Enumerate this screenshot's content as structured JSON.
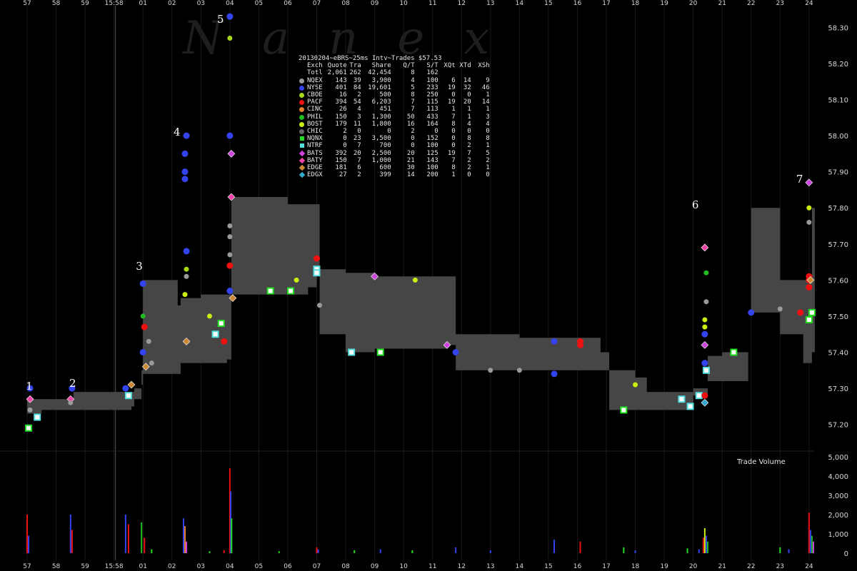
{
  "watermark": "Nanex",
  "stats": {
    "title": "20130204~eBRS~25ms Intv~Trades $57.53",
    "headers": [
      "Exch",
      "Quote",
      "Tra",
      "Share",
      "Q/T",
      "S/T",
      "XQt",
      "XTd",
      "XSh"
    ],
    "total": [
      "Totl",
      "2,061",
      "262",
      "42,454",
      "8",
      "162",
      "",
      "",
      ""
    ],
    "rows": [
      {
        "name": "NQEX",
        "shape": "dot",
        "color": "#9a9a9a",
        "vals": [
          "143",
          "39",
          "3,900",
          "4",
          "100",
          "6",
          "14",
          "9"
        ]
      },
      {
        "name": "NYSE",
        "shape": "dot",
        "color": "#3344ee",
        "vals": [
          "401",
          "84",
          "19,601",
          "5",
          "233",
          "19",
          "32",
          "46"
        ]
      },
      {
        "name": "CBOE",
        "shape": "dot",
        "color": "#a8d81a",
        "vals": [
          "16",
          "2",
          "500",
          "8",
          "250",
          "0",
          "0",
          "1"
        ]
      },
      {
        "name": "PACF",
        "shape": "dot",
        "color": "#ee1111",
        "vals": [
          "394",
          "54",
          "6,203",
          "7",
          "115",
          "19",
          "20",
          "14"
        ]
      },
      {
        "name": "CINC",
        "shape": "dot",
        "color": "#e08030",
        "vals": [
          "26",
          "4",
          "451",
          "7",
          "113",
          "1",
          "1",
          "1"
        ]
      },
      {
        "name": "PHIL",
        "shape": "dot",
        "color": "#22bb22",
        "vals": [
          "150",
          "3",
          "1,300",
          "50",
          "433",
          "7",
          "1",
          "3"
        ]
      },
      {
        "name": "BOST",
        "shape": "dot",
        "color": "#ccee11",
        "vals": [
          "179",
          "11",
          "1,800",
          "16",
          "164",
          "8",
          "4",
          "4"
        ]
      },
      {
        "name": "CHIC",
        "shape": "dot",
        "color": "#666666",
        "vals": [
          "2",
          "0",
          "0",
          "2",
          "0",
          "0",
          "0",
          "0"
        ]
      },
      {
        "name": "NQNX",
        "shape": "sq",
        "color": "#22dd22",
        "vals": [
          "0",
          "23",
          "3,500",
          "0",
          "152",
          "0",
          "8",
          "8"
        ]
      },
      {
        "name": "NTRF",
        "shape": "sq",
        "color": "#55dddd",
        "vals": [
          "0",
          "7",
          "700",
          "0",
          "100",
          "0",
          "2",
          "1"
        ]
      },
      {
        "name": "BATS",
        "shape": "dia",
        "color": "#cc44dd",
        "vals": [
          "392",
          "20",
          "2,500",
          "20",
          "125",
          "19",
          "7",
          "5"
        ]
      },
      {
        "name": "BATY",
        "shape": "dia",
        "color": "#ee44aa",
        "vals": [
          "150",
          "7",
          "1,000",
          "21",
          "143",
          "7",
          "2",
          "2"
        ]
      },
      {
        "name": "EDGE",
        "shape": "dia",
        "color": "#cc8833",
        "vals": [
          "181",
          "6",
          "600",
          "30",
          "100",
          "8",
          "2",
          "1"
        ]
      },
      {
        "name": "EDGX",
        "shape": "dia",
        "color": "#33aacc",
        "vals": [
          "27",
          "2",
          "399",
          "14",
          "200",
          "1",
          "0",
          "0"
        ]
      }
    ]
  },
  "volume_label": "Trade Volume",
  "chart_data": {
    "type": "line",
    "title": "20130204~eBRS~25ms Intv~Trades $57.53",
    "x_tick_labels": [
      "57",
      "58",
      "59",
      "15:58",
      "01",
      "02",
      "03",
      "04",
      "05",
      "06",
      "07",
      "08",
      "09",
      "10",
      "11",
      "12",
      "13",
      "14",
      "15",
      "16",
      "17",
      "18",
      "19",
      "20",
      "21",
      "22",
      "23",
      "24"
    ],
    "price_axis": {
      "ticks": [
        "57.20",
        "57.30",
        "57.40",
        "57.50",
        "57.60",
        "57.70",
        "57.80",
        "57.90",
        "58.00",
        "58.10",
        "58.20",
        "58.30"
      ],
      "ylim": [
        57.14,
        58.36
      ]
    },
    "volume_axis": {
      "ticks": [
        "0",
        "1,000",
        "2,000",
        "3,000",
        "4,000",
        "5,000"
      ],
      "ylim": [
        0,
        5000
      ]
    },
    "event_labels": [
      {
        "label": "1",
        "x": 0.4
      },
      {
        "label": "2",
        "x": 1.9
      },
      {
        "label": "3",
        "x": 4.2
      },
      {
        "label": "4",
        "x": 5.5
      },
      {
        "label": "5",
        "x": 7.0
      },
      {
        "label": "6",
        "x": 23.4
      },
      {
        "label": "7",
        "x": 27.0
      }
    ],
    "nbbo_series": [
      {
        "x": 0.0,
        "bid": 57.23,
        "ask": 57.27
      },
      {
        "x": 0.4,
        "bid": 57.23,
        "ask": 57.27
      },
      {
        "x": 0.5,
        "bid": 57.24,
        "ask": 57.27
      },
      {
        "x": 1.5,
        "bid": 57.24,
        "ask": 57.27
      },
      {
        "x": 1.6,
        "bid": 57.24,
        "ask": 57.29
      },
      {
        "x": 3.6,
        "bid": 57.25,
        "ask": 57.29
      },
      {
        "x": 3.7,
        "bid": 57.27,
        "ask": 57.3
      },
      {
        "x": 3.95,
        "bid": 57.31,
        "ask": 57.35
      },
      {
        "x": 4.0,
        "bid": 57.34,
        "ask": 57.6
      },
      {
        "x": 5.2,
        "bid": 57.34,
        "ask": 57.53
      },
      {
        "x": 5.3,
        "bid": 57.37,
        "ask": 57.55
      },
      {
        "x": 6.0,
        "bid": 57.37,
        "ask": 57.56
      },
      {
        "x": 6.5,
        "bid": 57.37,
        "ask": 57.56
      },
      {
        "x": 6.9,
        "bid": 57.38,
        "ask": 57.56
      },
      {
        "x": 7.05,
        "bid": 57.56,
        "ask": 57.83
      },
      {
        "x": 8.8,
        "bid": 57.56,
        "ask": 57.83
      },
      {
        "x": 9.0,
        "bid": 57.56,
        "ask": 57.81
      },
      {
        "x": 9.7,
        "bid": 57.58,
        "ask": 57.81
      },
      {
        "x": 10.0,
        "bid": 57.63,
        "ask": 57.81
      },
      {
        "x": 10.1,
        "bid": 57.45,
        "ask": 57.63
      },
      {
        "x": 11.0,
        "bid": 57.4,
        "ask": 57.62
      },
      {
        "x": 12.0,
        "bid": 57.41,
        "ask": 57.61
      },
      {
        "x": 13.0,
        "bid": 57.41,
        "ask": 57.61
      },
      {
        "x": 14.5,
        "bid": 57.42,
        "ask": 57.61
      },
      {
        "x": 14.8,
        "bid": 57.35,
        "ask": 57.45
      },
      {
        "x": 17.0,
        "bid": 57.35,
        "ask": 57.44
      },
      {
        "x": 18.0,
        "bid": 57.35,
        "ask": 57.44
      },
      {
        "x": 19.8,
        "bid": 57.35,
        "ask": 57.4
      },
      {
        "x": 20.1,
        "bid": 57.24,
        "ask": 57.35
      },
      {
        "x": 21.0,
        "bid": 57.24,
        "ask": 57.33
      },
      {
        "x": 21.4,
        "bid": 57.24,
        "ask": 57.29
      },
      {
        "x": 22.8,
        "bid": 57.24,
        "ask": 57.29
      },
      {
        "x": 23.0,
        "bid": 57.28,
        "ask": 57.3
      },
      {
        "x": 23.5,
        "bid": 57.32,
        "ask": 57.39
      },
      {
        "x": 24.0,
        "bid": 57.32,
        "ask": 57.4
      },
      {
        "x": 24.9,
        "bid": 57.4,
        "ask": 57.4
      },
      {
        "x": 25.0,
        "bid": 57.51,
        "ask": 57.8
      },
      {
        "x": 25.9,
        "bid": 57.51,
        "ask": 57.8
      },
      {
        "x": 26.0,
        "bid": 57.45,
        "ask": 57.6
      },
      {
        "x": 26.8,
        "bid": 57.37,
        "ask": 57.6
      },
      {
        "x": 27.1,
        "bid": 57.4,
        "ask": 57.8
      }
    ],
    "trades": [
      {
        "x": 0.1,
        "price": 57.24,
        "ex": "NQEX"
      },
      {
        "x": 0.1,
        "price": 57.3,
        "ex": "NYSE"
      },
      {
        "x": 0.1,
        "price": 57.27,
        "ex": "BATY"
      },
      {
        "x": 0.05,
        "price": 57.19,
        "ex": "NQNX"
      },
      {
        "x": 0.35,
        "price": 57.22,
        "ex": "NTRF"
      },
      {
        "x": 1.55,
        "price": 57.3,
        "ex": "NYSE"
      },
      {
        "x": 1.5,
        "price": 57.27,
        "ex": "BATY"
      },
      {
        "x": 1.5,
        "price": 57.26,
        "ex": "NQEX"
      },
      {
        "x": 3.4,
        "price": 57.3,
        "ex": "NYSE"
      },
      {
        "x": 3.5,
        "price": 57.28,
        "ex": "NTRF"
      },
      {
        "x": 3.6,
        "price": 57.31,
        "ex": "EDGE"
      },
      {
        "x": 4.0,
        "price": 57.5,
        "ex": "PHIL"
      },
      {
        "x": 4.0,
        "price": 57.59,
        "ex": "NYSE"
      },
      {
        "x": 4.0,
        "price": 57.4,
        "ex": "NYSE"
      },
      {
        "x": 4.05,
        "price": 57.47,
        "ex": "PACF"
      },
      {
        "x": 4.1,
        "price": 57.36,
        "ex": "EDGE"
      },
      {
        "x": 4.3,
        "price": 57.37,
        "ex": "NQEX"
      },
      {
        "x": 4.2,
        "price": 57.43,
        "ex": "NQEX"
      },
      {
        "x": 5.5,
        "price": 58.0,
        "ex": "NYSE"
      },
      {
        "x": 5.45,
        "price": 57.95,
        "ex": "NYSE"
      },
      {
        "x": 5.45,
        "price": 57.9,
        "ex": "NYSE"
      },
      {
        "x": 5.45,
        "price": 57.88,
        "ex": "NYSE"
      },
      {
        "x": 5.5,
        "price": 57.68,
        "ex": "NYSE"
      },
      {
        "x": 5.5,
        "price": 57.63,
        "ex": "CBOE"
      },
      {
        "x": 5.5,
        "price": 57.61,
        "ex": "NQEX"
      },
      {
        "x": 5.45,
        "price": 57.56,
        "ex": "BOST"
      },
      {
        "x": 5.5,
        "price": 57.43,
        "ex": "EDGE"
      },
      {
        "x": 6.3,
        "price": 57.5,
        "ex": "BOST"
      },
      {
        "x": 6.7,
        "price": 57.48,
        "ex": "NQNX"
      },
      {
        "x": 6.5,
        "price": 57.45,
        "ex": "NTRF"
      },
      {
        "x": 6.8,
        "price": 57.43,
        "ex": "PACF"
      },
      {
        "x": 7.0,
        "price": 58.33,
        "ex": "NYSE"
      },
      {
        "x": 7.0,
        "price": 58.27,
        "ex": "CBOE"
      },
      {
        "x": 7.0,
        "price": 58.0,
        "ex": "NYSE"
      },
      {
        "x": 7.05,
        "price": 57.95,
        "ex": "BATS"
      },
      {
        "x": 7.05,
        "price": 57.83,
        "ex": "BATY"
      },
      {
        "x": 7.0,
        "price": 57.75,
        "ex": "NQEX"
      },
      {
        "x": 7.0,
        "price": 57.72,
        "ex": "NQEX"
      },
      {
        "x": 7.0,
        "price": 57.67,
        "ex": "NQEX"
      },
      {
        "x": 7.0,
        "price": 57.64,
        "ex": "PACF"
      },
      {
        "x": 7.0,
        "price": 57.57,
        "ex": "NYSE"
      },
      {
        "x": 7.1,
        "price": 57.55,
        "ex": "EDGE"
      },
      {
        "x": 8.4,
        "price": 57.57,
        "ex": "NQNX"
      },
      {
        "x": 9.1,
        "price": 57.57,
        "ex": "NQNX"
      },
      {
        "x": 9.3,
        "price": 57.6,
        "ex": "BOST"
      },
      {
        "x": 10.0,
        "price": 57.66,
        "ex": "PACF"
      },
      {
        "x": 10.0,
        "price": 57.63,
        "ex": "NTRF"
      },
      {
        "x": 10.0,
        "price": 57.62,
        "ex": "NTRF"
      },
      {
        "x": 10.1,
        "price": 57.53,
        "ex": "NQEX"
      },
      {
        "x": 11.2,
        "price": 57.4,
        "ex": "NTRF"
      },
      {
        "x": 12.2,
        "price": 57.4,
        "ex": "NQNX"
      },
      {
        "x": 12.0,
        "price": 57.61,
        "ex": "BATS"
      },
      {
        "x": 13.4,
        "price": 57.6,
        "ex": "BOST"
      },
      {
        "x": 14.5,
        "price": 57.42,
        "ex": "BATS"
      },
      {
        "x": 14.8,
        "price": 57.4,
        "ex": "NYSE"
      },
      {
        "x": 16.0,
        "price": 57.35,
        "ex": "NQEX"
      },
      {
        "x": 17.0,
        "price": 57.35,
        "ex": "NQEX"
      },
      {
        "x": 18.2,
        "price": 57.34,
        "ex": "NYSE"
      },
      {
        "x": 18.2,
        "price": 57.43,
        "ex": "NYSE"
      },
      {
        "x": 19.1,
        "price": 57.43,
        "ex": "PACF"
      },
      {
        "x": 19.1,
        "price": 57.42,
        "ex": "PACF"
      },
      {
        "x": 20.6,
        "price": 57.24,
        "ex": "NQNX"
      },
      {
        "x": 21.0,
        "price": 57.31,
        "ex": "BOST"
      },
      {
        "x": 22.6,
        "price": 57.27,
        "ex": "NTRF"
      },
      {
        "x": 22.9,
        "price": 57.25,
        "ex": "NTRF"
      },
      {
        "x": 23.2,
        "price": 57.28,
        "ex": "NTRF"
      },
      {
        "x": 23.4,
        "price": 57.69,
        "ex": "BATY"
      },
      {
        "x": 23.45,
        "price": 57.62,
        "ex": "PHIL"
      },
      {
        "x": 23.45,
        "price": 57.54,
        "ex": "NQEX"
      },
      {
        "x": 23.4,
        "price": 57.49,
        "ex": "BOST"
      },
      {
        "x": 23.4,
        "price": 57.47,
        "ex": "BOST"
      },
      {
        "x": 23.4,
        "price": 57.45,
        "ex": "NYSE"
      },
      {
        "x": 23.4,
        "price": 57.42,
        "ex": "BATS"
      },
      {
        "x": 23.4,
        "price": 57.37,
        "ex": "NYSE"
      },
      {
        "x": 23.45,
        "price": 57.35,
        "ex": "NTRF"
      },
      {
        "x": 23.4,
        "price": 57.28,
        "ex": "PACF"
      },
      {
        "x": 23.4,
        "price": 57.26,
        "ex": "EDGX"
      },
      {
        "x": 24.4,
        "price": 57.4,
        "ex": "NQNX"
      },
      {
        "x": 25.0,
        "price": 57.51,
        "ex": "NYSE"
      },
      {
        "x": 26.0,
        "price": 57.52,
        "ex": "NQEX"
      },
      {
        "x": 26.7,
        "price": 57.51,
        "ex": "PACF"
      },
      {
        "x": 27.0,
        "price": 57.87,
        "ex": "BATS"
      },
      {
        "x": 27.0,
        "price": 57.8,
        "ex": "BOST"
      },
      {
        "x": 27.0,
        "price": 57.76,
        "ex": "NQEX"
      },
      {
        "x": 27.0,
        "price": 57.61,
        "ex": "PACF"
      },
      {
        "x": 27.0,
        "price": 57.6,
        "ex": "PACF"
      },
      {
        "x": 27.05,
        "price": 57.6,
        "ex": "EDGE"
      },
      {
        "x": 27.0,
        "price": 57.58,
        "ex": "PACF"
      },
      {
        "x": 27.1,
        "price": 57.51,
        "ex": "NQNX"
      },
      {
        "x": 27.0,
        "price": 57.49,
        "ex": "NQNX"
      }
    ],
    "volume_bars": [
      {
        "x": 0.0,
        "v": 2000,
        "c": "#ee1111"
      },
      {
        "x": 0.05,
        "v": 900,
        "c": "#3344ee"
      },
      {
        "x": 1.5,
        "v": 2000,
        "c": "#3344ee"
      },
      {
        "x": 1.55,
        "v": 1200,
        "c": "#ee1111"
      },
      {
        "x": 3.4,
        "v": 2000,
        "c": "#3344ee"
      },
      {
        "x": 3.5,
        "v": 1500,
        "c": "#ee1111"
      },
      {
        "x": 3.95,
        "v": 1600,
        "c": "#22bb22"
      },
      {
        "x": 4.05,
        "v": 800,
        "c": "#ee1111"
      },
      {
        "x": 4.3,
        "v": 200,
        "c": "#22dd22"
      },
      {
        "x": 5.4,
        "v": 1800,
        "c": "#3344ee"
      },
      {
        "x": 5.45,
        "v": 1400,
        "c": "#e08030"
      },
      {
        "x": 5.5,
        "v": 600,
        "c": "#cc44dd"
      },
      {
        "x": 6.3,
        "v": 100,
        "c": "#22dd22"
      },
      {
        "x": 6.8,
        "v": 150,
        "c": "#ee1111"
      },
      {
        "x": 7.0,
        "v": 4400,
        "c": "#ee1111"
      },
      {
        "x": 7.03,
        "v": 3200,
        "c": "#3344ee"
      },
      {
        "x": 7.06,
        "v": 1800,
        "c": "#22dd22"
      },
      {
        "x": 8.7,
        "v": 100,
        "c": "#22dd22"
      },
      {
        "x": 10.0,
        "v": 300,
        "c": "#ee1111"
      },
      {
        "x": 10.05,
        "v": 200,
        "c": "#3344ee"
      },
      {
        "x": 11.3,
        "v": 150,
        "c": "#22dd22"
      },
      {
        "x": 12.2,
        "v": 200,
        "c": "#3344ee"
      },
      {
        "x": 13.3,
        "v": 150,
        "c": "#22dd22"
      },
      {
        "x": 14.8,
        "v": 300,
        "c": "#3344ee"
      },
      {
        "x": 16.0,
        "v": 150,
        "c": "#3344ee"
      },
      {
        "x": 18.2,
        "v": 700,
        "c": "#3344ee"
      },
      {
        "x": 19.1,
        "v": 600,
        "c": "#ee1111"
      },
      {
        "x": 20.6,
        "v": 300,
        "c": "#22dd22"
      },
      {
        "x": 21.0,
        "v": 150,
        "c": "#3344ee"
      },
      {
        "x": 22.8,
        "v": 250,
        "c": "#22dd22"
      },
      {
        "x": 23.2,
        "v": 200,
        "c": "#3344ee"
      },
      {
        "x": 23.35,
        "v": 800,
        "c": "#ee1111"
      },
      {
        "x": 23.4,
        "v": 1300,
        "c": "#ccee11"
      },
      {
        "x": 23.45,
        "v": 900,
        "c": "#3344ee"
      },
      {
        "x": 23.5,
        "v": 600,
        "c": "#22bb22"
      },
      {
        "x": 26.0,
        "v": 300,
        "c": "#22dd22"
      },
      {
        "x": 26.3,
        "v": 200,
        "c": "#3344ee"
      },
      {
        "x": 27.0,
        "v": 2100,
        "c": "#ee1111"
      },
      {
        "x": 27.05,
        "v": 1200,
        "c": "#3344ee"
      },
      {
        "x": 27.1,
        "v": 900,
        "c": "#22bb22"
      },
      {
        "x": 27.15,
        "v": 600,
        "c": "#cc44dd"
      }
    ]
  }
}
